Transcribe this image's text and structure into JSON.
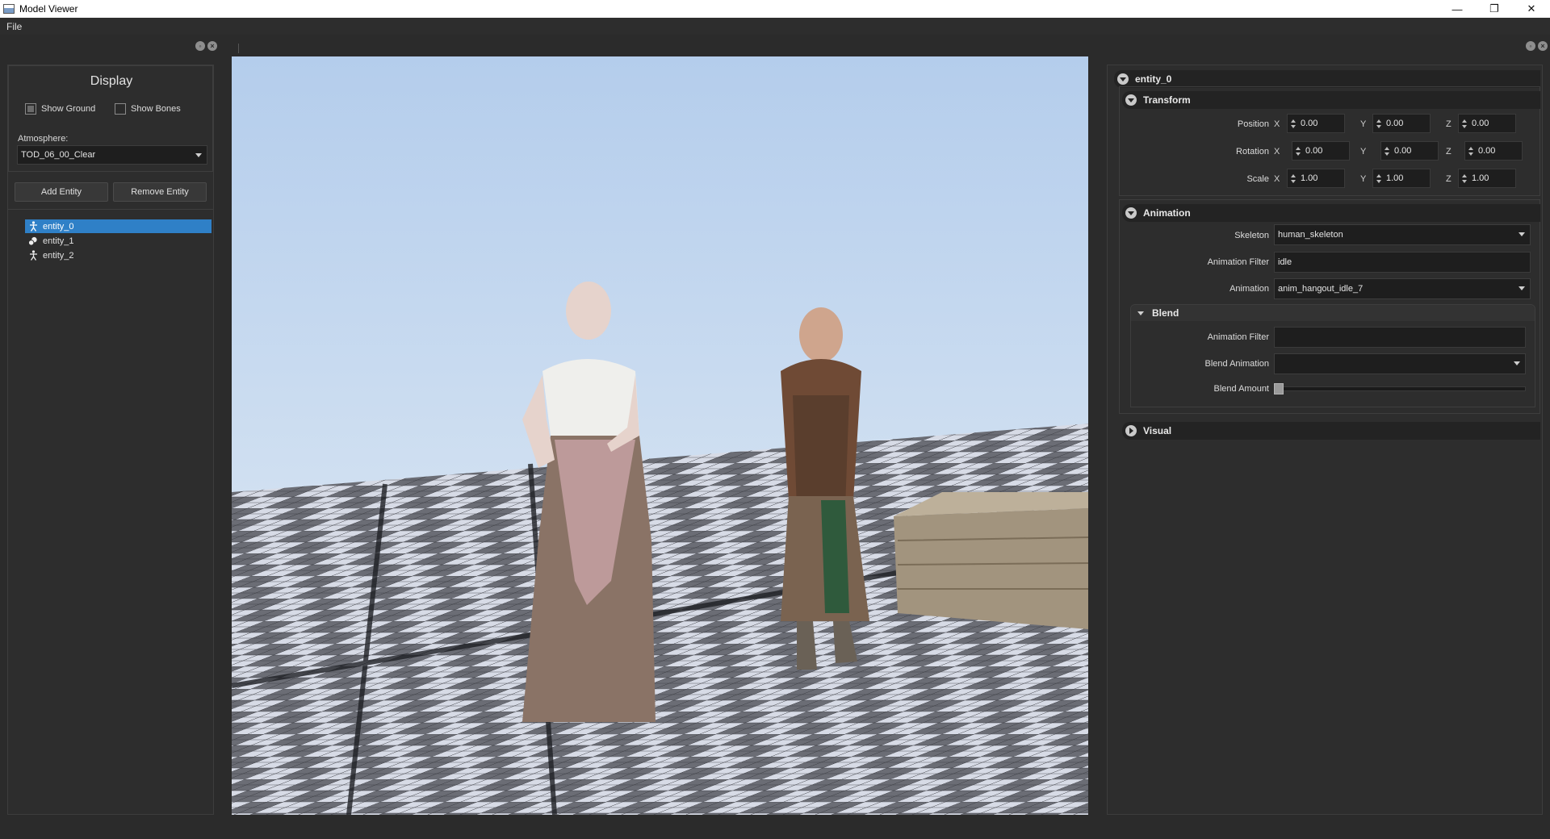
{
  "window": {
    "title": "Model Viewer",
    "minimize": "—",
    "restore": "❐",
    "close": "✕"
  },
  "menu": {
    "file": "File"
  },
  "display": {
    "title": "Display",
    "show_ground": {
      "label": "Show Ground",
      "checked": true
    },
    "show_bones": {
      "label": "Show Bones",
      "checked": false
    },
    "atmosphere_label": "Atmosphere:",
    "atmosphere_value": "TOD_06_00_Clear"
  },
  "buttons": {
    "add_entity": "Add Entity",
    "remove_entity": "Remove Entity"
  },
  "entities": [
    {
      "label": "entity_0",
      "icon": "person-icon",
      "selected": true
    },
    {
      "label": "entity_1",
      "icon": "object-icon",
      "selected": false
    },
    {
      "label": "entity_2",
      "icon": "person-icon",
      "selected": false
    }
  ],
  "inspector": {
    "entity_name": "entity_0",
    "transform": {
      "header": "Transform",
      "position": {
        "label": "Position",
        "x": "0.00",
        "y": "0.00",
        "z": "0.00"
      },
      "rotation": {
        "label": "Rotation",
        "x": "0.00",
        "y": "0.00",
        "z": "0.00"
      },
      "scale": {
        "label": "Scale",
        "x": "1.00",
        "y": "1.00",
        "z": "1.00"
      },
      "axis_x": "X",
      "axis_y": "Y",
      "axis_z": "Z"
    },
    "animation": {
      "header": "Animation",
      "skeleton_label": "Skeleton",
      "skeleton_value": "human_skeleton",
      "filter_label": "Animation Filter",
      "filter_value": "idle",
      "animation_label": "Animation",
      "animation_value": "anim_hangout_idle_7",
      "blend": {
        "header": "Blend",
        "filter_label": "Animation Filter",
        "filter_value": "",
        "blend_anim_label": "Blend Animation",
        "blend_anim_value": "",
        "amount_label": "Blend Amount",
        "amount": 0
      }
    },
    "visual": {
      "header": "Visual"
    }
  },
  "colors": {
    "selection": "#2f80c7",
    "sky": "#bcd3ee",
    "panel": "#2d2d2d"
  }
}
